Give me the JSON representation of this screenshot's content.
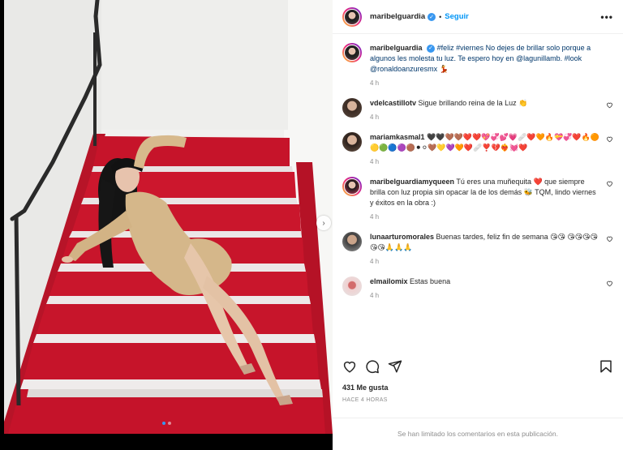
{
  "post": {
    "username": "maribelguardia",
    "follow_label": "Seguir",
    "more_label": "•••",
    "caption": {
      "username": "maribelguardia",
      "text": "#feliz #viernes No dejes de brillar solo porque a algunos les molesta tu luz. Te espero hoy en @lagunillamb. #look @ronaldoanzuresmx 💃",
      "time": "4 h"
    },
    "comments": [
      {
        "username": "vdelcastillotv",
        "text": "Sigue brillando reina de la Luz 👏",
        "time": "4 h"
      },
      {
        "username": "mariamkasmal1",
        "text": "🖤🖤🤎🤎❤️❤️💖💞💕💗🩹❤️🧡🔥💝💞❤️🔥🟠🟡🟢🔵🟣🟤⚫⚪🤎💛💜🧡❤️🩹❣️💔❤️‍🔥💓❤️",
        "time": "4 h"
      },
      {
        "username": "maribelguardiamyqueen",
        "text": "Tú eres una muñequita ❤️ que siempre brilla con luz propia sin opacar la de los demás 🐝 TQM, lindo viernes y éxitos en la obra :)",
        "time": "4 h"
      },
      {
        "username": "lunaarturomorales",
        "text": "Buenas tardes, feliz fin de semana 😘😘 😘😘😘😘😘😘🙏🙏🙏",
        "time": "4 h"
      },
      {
        "username": "elmailomix",
        "text": "Estas buena",
        "time": "4 h"
      }
    ],
    "likes": "431 Me gusta",
    "ago": "HACE 4 HORAS",
    "comments_limited": "Se han limitado los comentarios en esta publicación."
  },
  "icons": {
    "verified": "verified-badge-icon",
    "heart": "heart-icon",
    "comment": "comment-icon",
    "share": "share-icon",
    "save": "bookmark-icon",
    "next": "chevron-right-icon"
  },
  "colors": {
    "accent_blue": "#0095f6",
    "verified_blue": "#3897f0",
    "stairs_red": "#c8152a",
    "text": "#262626",
    "muted": "#8e8e8e"
  }
}
